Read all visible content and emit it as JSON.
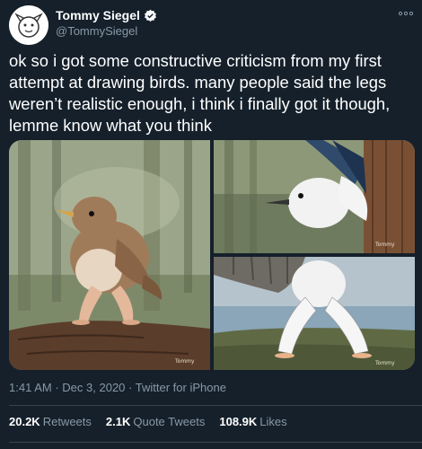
{
  "user": {
    "display_name": "Tommy Siegel",
    "handle": "@TommySiegel"
  },
  "tweet": {
    "text": "ok so i got some constructive criticism from my first attempt at drawing birds. many people said the legs weren’t realistic enough, i think i finally got it though, lemme know what you think"
  },
  "media": {
    "images": [
      {
        "description": "wren"
      },
      {
        "description": "nuthatch"
      },
      {
        "description": "gull"
      }
    ]
  },
  "meta": {
    "time": "1:41 AM",
    "date": "Dec 3, 2020",
    "source": "Twitter for iPhone",
    "separator": "·"
  },
  "stats": {
    "retweets_count": "20.2K",
    "retweets_label": "Retweets",
    "quotes_count": "2.1K",
    "quotes_label": "Quote Tweets",
    "likes_count": "108.9K",
    "likes_label": "Likes"
  },
  "colors": {
    "background": "#15202b",
    "secondary_text": "#8899a6",
    "verified_blue": "#1da1f2"
  }
}
